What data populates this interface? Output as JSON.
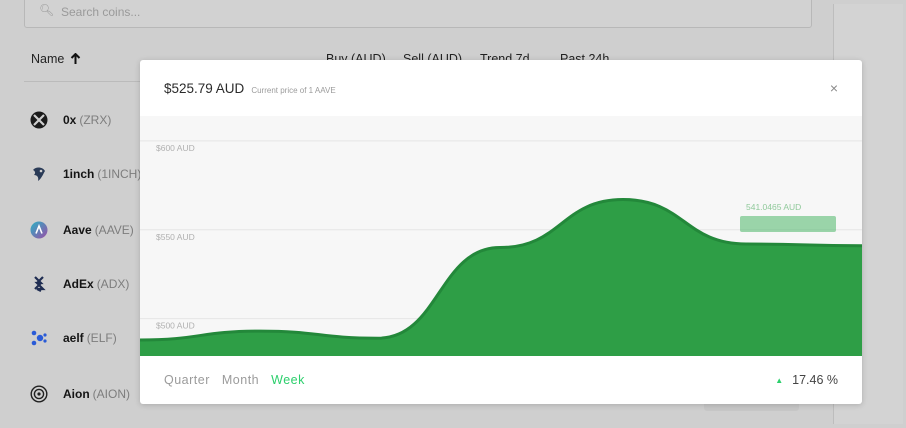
{
  "search": {
    "placeholder": "Search coins..."
  },
  "table": {
    "headers": {
      "name": "Name",
      "buy": "Buy (AUD)",
      "sell": "Sell (AUD)",
      "trend": "Trend 7d",
      "past": "Past 24h"
    },
    "coins": [
      {
        "name": "0x",
        "ticker": "(ZRX)",
        "icon": "zrx-icon"
      },
      {
        "name": "1inch",
        "ticker": "(1INCH)",
        "icon": "1inch-icon"
      },
      {
        "name": "Aave",
        "ticker": "(AAVE)",
        "icon": "aave-icon"
      },
      {
        "name": "AdEx",
        "ticker": "(ADX)",
        "icon": "adex-icon"
      },
      {
        "name": "aelf",
        "ticker": "(ELF)",
        "icon": "aelf-icon"
      },
      {
        "name": "Aion",
        "ticker": "(AION)",
        "icon": "aion-icon"
      }
    ]
  },
  "modal": {
    "price": "$525.79 AUD",
    "price_caption": "Current price of 1 AAVE",
    "close_label": "×",
    "tabs": [
      "Quarter",
      "Month",
      "Week"
    ],
    "active_tab": "Week",
    "change": "17.46 %",
    "change_direction": "up",
    "accent_color": "#2ccf6c"
  },
  "chart_data": {
    "type": "area",
    "y_tick_labels": [
      "$600 AUD",
      "$550 AUD",
      "$500 AUD"
    ],
    "y_ticks": [
      600,
      550,
      500
    ],
    "tooltip_label": "541.0465 AUD",
    "x": [
      0,
      1,
      2,
      3,
      4,
      5,
      6
    ],
    "values": [
      488,
      493,
      489,
      540,
      567,
      542,
      541
    ],
    "ylim": [
      479,
      614
    ],
    "fill_color": "#2e9e46",
    "line_color": "#23883a",
    "grid": true
  }
}
